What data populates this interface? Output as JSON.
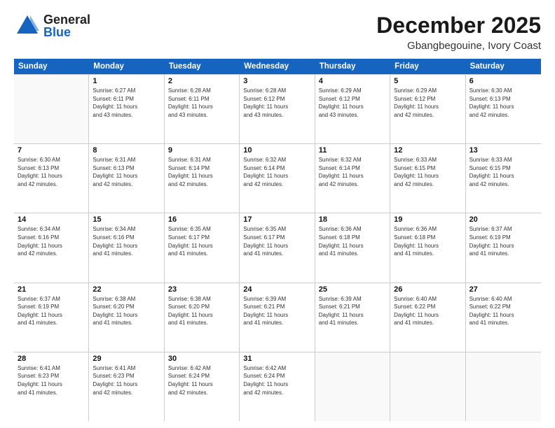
{
  "header": {
    "logo_general": "General",
    "logo_blue": "Blue",
    "month_title": "December 2025",
    "location": "Gbangbegouine, Ivory Coast"
  },
  "calendar": {
    "days_of_week": [
      "Sunday",
      "Monday",
      "Tuesday",
      "Wednesday",
      "Thursday",
      "Friday",
      "Saturday"
    ],
    "weeks": [
      [
        {
          "day": "",
          "info": ""
        },
        {
          "day": "1",
          "info": "Sunrise: 6:27 AM\nSunset: 6:11 PM\nDaylight: 11 hours\nand 43 minutes."
        },
        {
          "day": "2",
          "info": "Sunrise: 6:28 AM\nSunset: 6:11 PM\nDaylight: 11 hours\nand 43 minutes."
        },
        {
          "day": "3",
          "info": "Sunrise: 6:28 AM\nSunset: 6:12 PM\nDaylight: 11 hours\nand 43 minutes."
        },
        {
          "day": "4",
          "info": "Sunrise: 6:29 AM\nSunset: 6:12 PM\nDaylight: 11 hours\nand 43 minutes."
        },
        {
          "day": "5",
          "info": "Sunrise: 6:29 AM\nSunset: 6:12 PM\nDaylight: 11 hours\nand 42 minutes."
        },
        {
          "day": "6",
          "info": "Sunrise: 6:30 AM\nSunset: 6:13 PM\nDaylight: 11 hours\nand 42 minutes."
        }
      ],
      [
        {
          "day": "7",
          "info": "Sunrise: 6:30 AM\nSunset: 6:13 PM\nDaylight: 11 hours\nand 42 minutes."
        },
        {
          "day": "8",
          "info": "Sunrise: 6:31 AM\nSunset: 6:13 PM\nDaylight: 11 hours\nand 42 minutes."
        },
        {
          "day": "9",
          "info": "Sunrise: 6:31 AM\nSunset: 6:14 PM\nDaylight: 11 hours\nand 42 minutes."
        },
        {
          "day": "10",
          "info": "Sunrise: 6:32 AM\nSunset: 6:14 PM\nDaylight: 11 hours\nand 42 minutes."
        },
        {
          "day": "11",
          "info": "Sunrise: 6:32 AM\nSunset: 6:14 PM\nDaylight: 11 hours\nand 42 minutes."
        },
        {
          "day": "12",
          "info": "Sunrise: 6:33 AM\nSunset: 6:15 PM\nDaylight: 11 hours\nand 42 minutes."
        },
        {
          "day": "13",
          "info": "Sunrise: 6:33 AM\nSunset: 6:15 PM\nDaylight: 11 hours\nand 42 minutes."
        }
      ],
      [
        {
          "day": "14",
          "info": "Sunrise: 6:34 AM\nSunset: 6:16 PM\nDaylight: 11 hours\nand 42 minutes."
        },
        {
          "day": "15",
          "info": "Sunrise: 6:34 AM\nSunset: 6:16 PM\nDaylight: 11 hours\nand 41 minutes."
        },
        {
          "day": "16",
          "info": "Sunrise: 6:35 AM\nSunset: 6:17 PM\nDaylight: 11 hours\nand 41 minutes."
        },
        {
          "day": "17",
          "info": "Sunrise: 6:35 AM\nSunset: 6:17 PM\nDaylight: 11 hours\nand 41 minutes."
        },
        {
          "day": "18",
          "info": "Sunrise: 6:36 AM\nSunset: 6:18 PM\nDaylight: 11 hours\nand 41 minutes."
        },
        {
          "day": "19",
          "info": "Sunrise: 6:36 AM\nSunset: 6:18 PM\nDaylight: 11 hours\nand 41 minutes."
        },
        {
          "day": "20",
          "info": "Sunrise: 6:37 AM\nSunset: 6:19 PM\nDaylight: 11 hours\nand 41 minutes."
        }
      ],
      [
        {
          "day": "21",
          "info": "Sunrise: 6:37 AM\nSunset: 6:19 PM\nDaylight: 11 hours\nand 41 minutes."
        },
        {
          "day": "22",
          "info": "Sunrise: 6:38 AM\nSunset: 6:20 PM\nDaylight: 11 hours\nand 41 minutes."
        },
        {
          "day": "23",
          "info": "Sunrise: 6:38 AM\nSunset: 6:20 PM\nDaylight: 11 hours\nand 41 minutes."
        },
        {
          "day": "24",
          "info": "Sunrise: 6:39 AM\nSunset: 6:21 PM\nDaylight: 11 hours\nand 41 minutes."
        },
        {
          "day": "25",
          "info": "Sunrise: 6:39 AM\nSunset: 6:21 PM\nDaylight: 11 hours\nand 41 minutes."
        },
        {
          "day": "26",
          "info": "Sunrise: 6:40 AM\nSunset: 6:22 PM\nDaylight: 11 hours\nand 41 minutes."
        },
        {
          "day": "27",
          "info": "Sunrise: 6:40 AM\nSunset: 6:22 PM\nDaylight: 11 hours\nand 41 minutes."
        }
      ],
      [
        {
          "day": "28",
          "info": "Sunrise: 6:41 AM\nSunset: 6:23 PM\nDaylight: 11 hours\nand 41 minutes."
        },
        {
          "day": "29",
          "info": "Sunrise: 6:41 AM\nSunset: 6:23 PM\nDaylight: 11 hours\nand 42 minutes."
        },
        {
          "day": "30",
          "info": "Sunrise: 6:42 AM\nSunset: 6:24 PM\nDaylight: 11 hours\nand 42 minutes."
        },
        {
          "day": "31",
          "info": "Sunrise: 6:42 AM\nSunset: 6:24 PM\nDaylight: 11 hours\nand 42 minutes."
        },
        {
          "day": "",
          "info": ""
        },
        {
          "day": "",
          "info": ""
        },
        {
          "day": "",
          "info": ""
        }
      ]
    ]
  }
}
